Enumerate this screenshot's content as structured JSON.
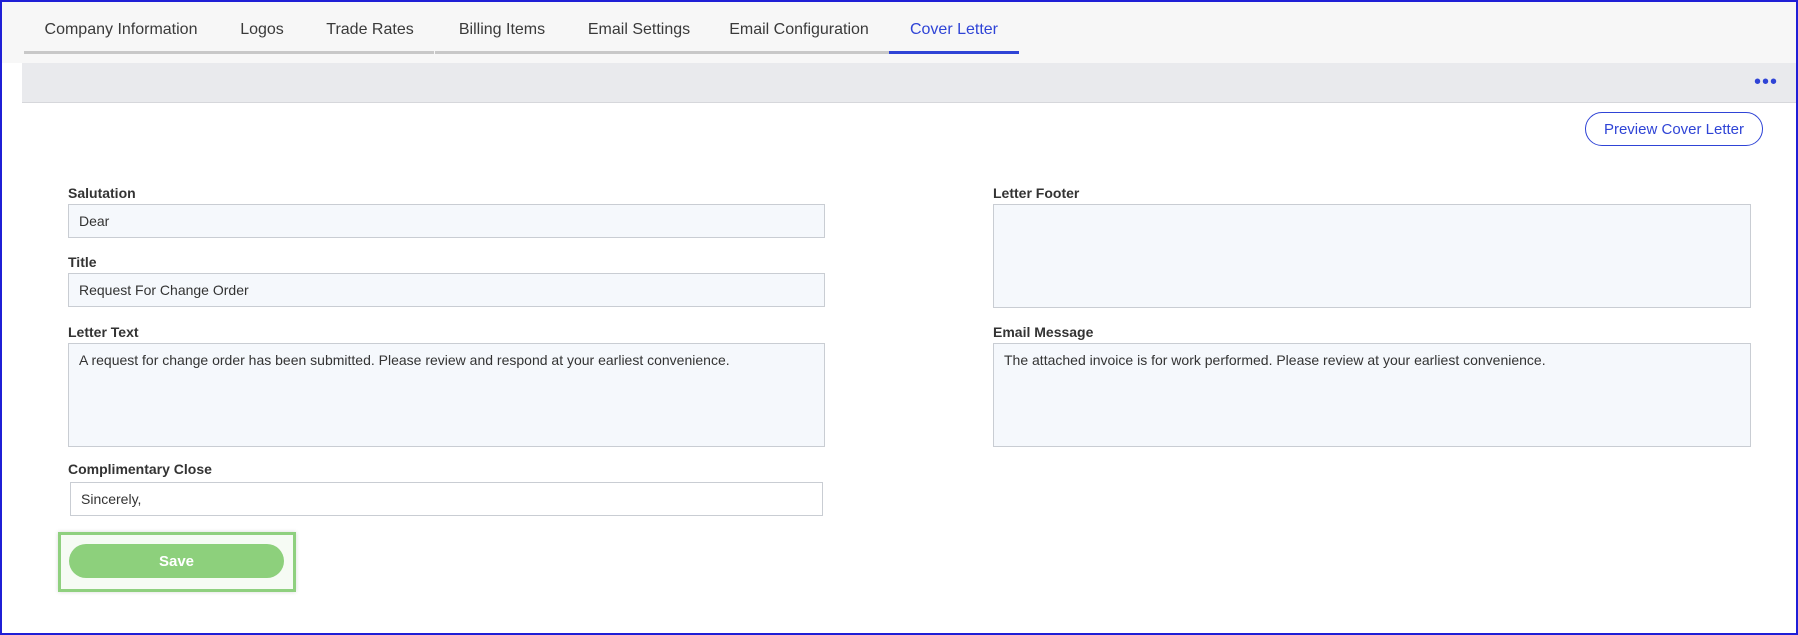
{
  "tabs": [
    {
      "label": "Company Information"
    },
    {
      "label": "Logos"
    },
    {
      "label": "Trade Rates"
    },
    {
      "label": "Billing Items"
    },
    {
      "label": "Email Settings"
    },
    {
      "label": "Email Configuration"
    },
    {
      "label": "Cover Letter",
      "active": true
    }
  ],
  "toolbar": {
    "more_icon": "more-horizontal-icon"
  },
  "preview_button": "Preview Cover Letter",
  "form": {
    "salutation": {
      "label": "Salutation",
      "value": "Dear"
    },
    "title": {
      "label": "Title",
      "value": "Request For Change Order"
    },
    "letter_text": {
      "label": "Letter Text",
      "value": "A request for change order has been submitted. Please review and respond at your earliest convenience."
    },
    "complimentary_close": {
      "label": "Complimentary Close",
      "value": "Sincerely,"
    },
    "letter_footer": {
      "label": "Letter Footer",
      "value": ""
    },
    "email_message": {
      "label": "Email Message",
      "value": "The attached invoice is for work performed. Please review at your earliest convenience."
    }
  },
  "save_button": "Save",
  "colors": {
    "accent": "#2f44d6",
    "save": "#8dd07c"
  }
}
